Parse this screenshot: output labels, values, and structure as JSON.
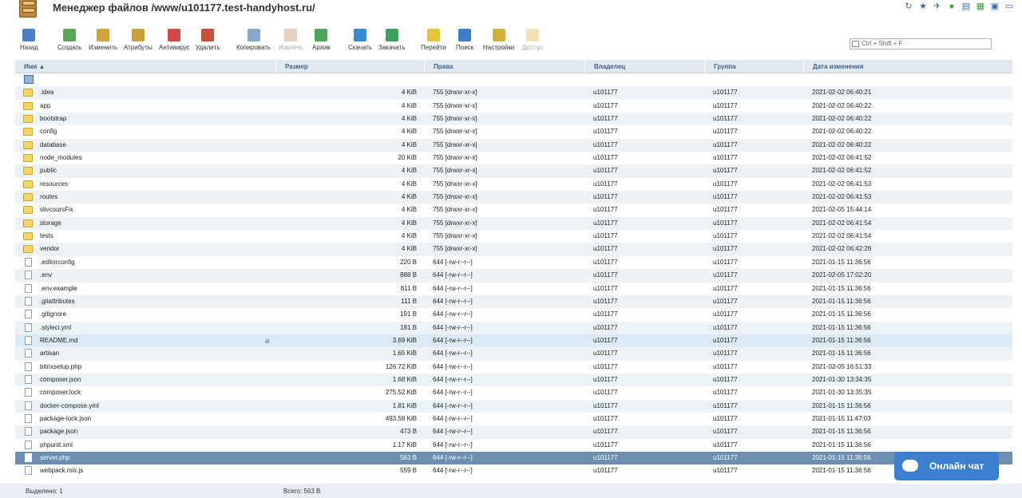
{
  "title": "Менеджер файлов /www/u101177.test-handyhost.ru/",
  "toolbar": {
    "buttons": [
      {
        "label": "Назад",
        "icon": "back-arrow-icon",
        "color": "#4a7fc8",
        "disabled": false
      },
      {
        "label": "Создать",
        "icon": "create-icon",
        "color": "#5aa55a",
        "disabled": false
      },
      {
        "label": "Изменить",
        "icon": "edit-icon",
        "color": "#d4a23a",
        "disabled": false
      },
      {
        "label": "Атрибуты",
        "icon": "attributes-icon",
        "color": "#c9a03c",
        "disabled": false
      },
      {
        "label": "Антивирус",
        "icon": "antivirus-icon",
        "color": "#d04a4a",
        "disabled": false
      },
      {
        "label": "Удалить",
        "icon": "delete-icon",
        "color": "#c8503a",
        "disabled": false
      },
      {
        "label": "Копировать",
        "icon": "copy-icon",
        "color": "#8aa7c7",
        "disabled": false
      },
      {
        "label": "Извлечь",
        "icon": "extract-icon",
        "color": "#b87a4a",
        "disabled": true
      },
      {
        "label": "Архив",
        "icon": "archive-icon",
        "color": "#4aa55a",
        "disabled": false
      },
      {
        "label": "Скачать",
        "icon": "download-icon",
        "color": "#3a8ad0",
        "disabled": false
      },
      {
        "label": "Закачать",
        "icon": "upload-icon",
        "color": "#3aa05a",
        "disabled": false
      },
      {
        "label": "Перейти",
        "icon": "go-folder-icon",
        "color": "#e6c23a",
        "disabled": false
      },
      {
        "label": "Поиск",
        "icon": "search-icon",
        "color": "#3a7fc8",
        "disabled": false
      },
      {
        "label": "Настройки",
        "icon": "gear-icon",
        "color": "#d4b03a",
        "disabled": false
      },
      {
        "label": "Доступ",
        "icon": "lock-icon",
        "color": "#d4b03a",
        "disabled": true
      }
    ]
  },
  "search": {
    "placeholder": "Ctrl + Shift + F"
  },
  "columns": {
    "name": "Имя ▲",
    "size": "Размер",
    "perms": "Права",
    "owner": "Владелец",
    "group": "Группа",
    "date": "Дата изменения"
  },
  "rows": [
    {
      "name": ".idea",
      "type": "folder",
      "size": "4 KiB",
      "perms": "755 [drwxr-xr-x]",
      "owner": "u101177",
      "group": "u101177",
      "date": "2021-02-02 06:40:21"
    },
    {
      "name": "app",
      "type": "folder",
      "size": "4 KiB",
      "perms": "755 [drwxr-xr-x]",
      "owner": "u101177",
      "group": "u101177",
      "date": "2021-02-02 06:40:22"
    },
    {
      "name": "bootstrap",
      "type": "folder",
      "size": "4 KiB",
      "perms": "755 [drwxr-xr-x]",
      "owner": "u101177",
      "group": "u101177",
      "date": "2021-02-02 06:40:22"
    },
    {
      "name": "config",
      "type": "folder",
      "size": "4 KiB",
      "perms": "755 [drwxr-xr-x]",
      "owner": "u101177",
      "group": "u101177",
      "date": "2021-02-02 06:40:22"
    },
    {
      "name": "database",
      "type": "folder",
      "size": "4 KiB",
      "perms": "755 [drwxr-xr-x]",
      "owner": "u101177",
      "group": "u101177",
      "date": "2021-02-02 06:40:22"
    },
    {
      "name": "node_modules",
      "type": "folder",
      "size": "20 KiB",
      "perms": "755 [drwxr-xr-x]",
      "owner": "u101177",
      "group": "u101177",
      "date": "2021-02-02 06:41:52"
    },
    {
      "name": "public",
      "type": "folder",
      "size": "4 KiB",
      "perms": "755 [drwxr-xr-x]",
      "owner": "u101177",
      "group": "u101177",
      "date": "2021-02-02 06:41:52"
    },
    {
      "name": "resources",
      "type": "folder",
      "size": "4 KiB",
      "perms": "755 [drwxr-xr-x]",
      "owner": "u101177",
      "group": "u101177",
      "date": "2021-02-02 06:41:53"
    },
    {
      "name": "routes",
      "type": "folder",
      "size": "4 KiB",
      "perms": "755 [drwxr-xr-x]",
      "owner": "u101177",
      "group": "u101177",
      "date": "2021-02-02 06:41:53"
    },
    {
      "name": "slivcoursFix",
      "type": "folder",
      "size": "4 KiB",
      "perms": "755 [drwxr-xr-x]",
      "owner": "u101177",
      "group": "u101177",
      "date": "2021-02-05 15:44:14"
    },
    {
      "name": "storage",
      "type": "folder",
      "size": "4 KiB",
      "perms": "755 [drwxr-xr-x]",
      "owner": "u101177",
      "group": "u101177",
      "date": "2021-02-02 06:41:54"
    },
    {
      "name": "tests",
      "type": "folder",
      "size": "4 KiB",
      "perms": "755 [drwxr-xr-x]",
      "owner": "u101177",
      "group": "u101177",
      "date": "2021-02-02 06:41:54"
    },
    {
      "name": "vendor",
      "type": "folder",
      "size": "4 KiB",
      "perms": "755 [drwxr-xr-x]",
      "owner": "u101177",
      "group": "u101177",
      "date": "2021-02-02 06:42:26"
    },
    {
      "name": ".editorconfig",
      "type": "file",
      "size": "220 B",
      "perms": "644 [-rw-r--r--]",
      "owner": "u101177",
      "group": "u101177",
      "date": "2021-01-15 11:36:56"
    },
    {
      "name": ".env",
      "type": "file",
      "size": "888 B",
      "perms": "644 [-rw-r--r--]",
      "owner": "u101177",
      "group": "u101177",
      "date": "2021-02-05 17:02:20"
    },
    {
      "name": ".env.example",
      "type": "file",
      "size": "811 B",
      "perms": "644 [-rw-r--r--]",
      "owner": "u101177",
      "group": "u101177",
      "date": "2021-01-15 11:36:56"
    },
    {
      "name": ".gitattributes",
      "type": "file",
      "size": "111 B",
      "perms": "644 [-rw-r--r--]",
      "owner": "u101177",
      "group": "u101177",
      "date": "2021-01-15 11:36:56"
    },
    {
      "name": ".gitignore",
      "type": "file",
      "size": "191 B",
      "perms": "644 [-rw-r--r--]",
      "owner": "u101177",
      "group": "u101177",
      "date": "2021-01-15 11:36:56"
    },
    {
      "name": ".styleci.yml",
      "type": "file",
      "size": "181 B",
      "perms": "644 [-rw-r--r--]",
      "owner": "u101177",
      "group": "u101177",
      "date": "2021-01-15 11:36:56"
    },
    {
      "name": "README.md",
      "type": "file",
      "size": "3.69 KiB",
      "perms": "644 [-rw-r--r--]",
      "owner": "u101177",
      "group": "u101177",
      "date": "2021-01-15 11:36:56",
      "state": "highlight"
    },
    {
      "name": "artisan",
      "type": "file",
      "size": "1.65 KiB",
      "perms": "644 [-rw-r--r--]",
      "owner": "u101177",
      "group": "u101177",
      "date": "2021-01-15 11:36:56"
    },
    {
      "name": "bitrixsetup.php",
      "type": "file",
      "size": "126.72 KiB",
      "perms": "644 [-rw-r--r--]",
      "owner": "u101177",
      "group": "u101177",
      "date": "2021-02-05 16:51:33"
    },
    {
      "name": "composer.json",
      "type": "file",
      "size": "1.68 KiB",
      "perms": "644 [-rw-r--r--]",
      "owner": "u101177",
      "group": "u101177",
      "date": "2021-01-30 13:34:35"
    },
    {
      "name": "composer.lock",
      "type": "file",
      "size": "275.52 KiB",
      "perms": "644 [-rw-r--r--]",
      "owner": "u101177",
      "group": "u101177",
      "date": "2021-01-30 13:35:35"
    },
    {
      "name": "docker-compose.yml",
      "type": "file",
      "size": "1.81 KiB",
      "perms": "644 [-rw-r--r--]",
      "owner": "u101177",
      "group": "u101177",
      "date": "2021-01-15 11:36:56"
    },
    {
      "name": "package-lock.json",
      "type": "file",
      "size": "493.58 KiB",
      "perms": "644 [-rw-r--r--]",
      "owner": "u101177",
      "group": "u101177",
      "date": "2021-01-15 11:47:03"
    },
    {
      "name": "package.json",
      "type": "file",
      "size": "473 B",
      "perms": "644 [-rw-r--r--]",
      "owner": "u101177",
      "group": "u101177",
      "date": "2021-01-15 11:36:56"
    },
    {
      "name": "phpunit.xml",
      "type": "file",
      "size": "1.17 KiB",
      "perms": "644 [-rw-r--r--]",
      "owner": "u101177",
      "group": "u101177",
      "date": "2021-01-15 11:36:56"
    },
    {
      "name": "server.php",
      "type": "file",
      "size": "563 B",
      "perms": "644 [-rw-r--r--]",
      "owner": "u101177",
      "group": "u101177",
      "date": "2021-01-15 11:36:56",
      "state": "selected"
    },
    {
      "name": "webpack.mix.js",
      "type": "file",
      "size": "559 B",
      "perms": "644 [-rw-r--r--]",
      "owner": "u101177",
      "group": "u101177",
      "date": "2021-01-15 11:36:56"
    }
  ],
  "footer": {
    "selected": "Выделено: 1",
    "total": "Всего: 563 B"
  },
  "chat": {
    "label": "Онлайн чат",
    "color": "#3a7fd0"
  }
}
